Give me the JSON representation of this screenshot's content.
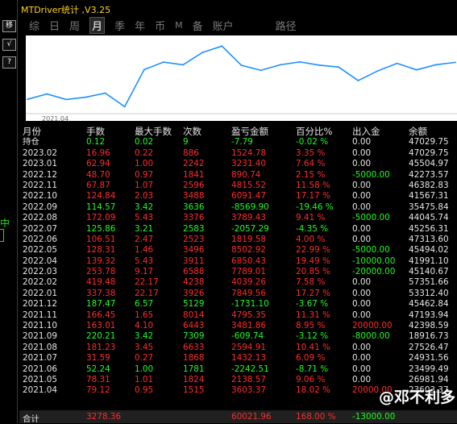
{
  "window": {
    "title": "MTDriver统计 ,V3.25"
  },
  "sidebar": {
    "buttons": [
      "移",
      "√",
      "?"
    ],
    "marker": "中"
  },
  "tabs": [
    {
      "label": "综",
      "active": false
    },
    {
      "label": "日",
      "active": false
    },
    {
      "label": "周",
      "active": false
    },
    {
      "label": "月",
      "active": true
    },
    {
      "label": "季",
      "active": false
    },
    {
      "label": "年",
      "active": false
    },
    {
      "label": "币",
      "active": false
    },
    {
      "label": "M",
      "active": false
    },
    {
      "label": "备",
      "active": false
    },
    {
      "label": "账户",
      "active": false
    },
    {
      "label": "路径",
      "active": false
    }
  ],
  "chart_data": {
    "type": "line",
    "xlabel": "2021.04",
    "x": [
      "2021.04",
      "2021.05",
      "2021.06",
      "2021.07",
      "2021.08",
      "2021.09",
      "2021.10",
      "2021.11",
      "2021.12",
      "2022.01",
      "2022.02",
      "2022.03",
      "2022.04",
      "2022.05",
      "2022.06",
      "2022.07",
      "2022.08",
      "2022.09",
      "2022.10",
      "2022.11",
      "2022.12",
      "2023.01",
      "2023.02"
    ],
    "series": [
      {
        "values": [
          23603.37,
          26981.94,
          23499.49,
          24931.56,
          27526.47,
          18916.73,
          42398.59,
          47193.94,
          45462.84,
          53312.4,
          57351.66,
          45140.67,
          41991.1,
          45494.02,
          47313.6,
          45256.31,
          44045.74,
          35475.84,
          41567.31,
          46382.83,
          42273.57,
          45504.97,
          47029.75
        ]
      }
    ]
  },
  "table": {
    "headers": [
      "月份",
      "手数",
      "最大手数",
      "次数",
      "盈亏金额",
      "百分比%",
      "出入金",
      "余额"
    ],
    "rows": [
      {
        "month": "持仓",
        "lots": "0.12",
        "max_lots": "0.02",
        "count": "9",
        "pnl": "-7.79",
        "pct": "-0.02 %",
        "flow": "0.00",
        "balance": "47029.75",
        "color": "green",
        "flow_color": "white"
      },
      {
        "month": "2023.02",
        "lots": "16.96",
        "max_lots": "0.22",
        "count": "886",
        "pnl": "1524.78",
        "pct": "3.35 %",
        "flow": "0.00",
        "balance": "47029.75",
        "color": "red",
        "flow_color": "white"
      },
      {
        "month": "2023.01",
        "lots": "62.94",
        "max_lots": "1.00",
        "count": "2242",
        "pnl": "3231.40",
        "pct": "7.64 %",
        "flow": "0.00",
        "balance": "45504.97",
        "color": "red",
        "flow_color": "white"
      },
      {
        "month": "2022.12",
        "lots": "48.70",
        "max_lots": "0.97",
        "count": "1841",
        "pnl": "890.74",
        "pct": "2.15 %",
        "flow": "-5000.00",
        "balance": "42273.57",
        "color": "red",
        "flow_color": "green"
      },
      {
        "month": "2022.11",
        "lots": "67.87",
        "max_lots": "1.07",
        "count": "2596",
        "pnl": "4815.52",
        "pct": "11.58 %",
        "flow": "0.00",
        "balance": "46382.83",
        "color": "red",
        "flow_color": "white"
      },
      {
        "month": "2022.10",
        "lots": "124.84",
        "max_lots": "2.03",
        "count": "3488",
        "pnl": "6091.47",
        "pct": "17.17 %",
        "flow": "0.00",
        "balance": "41567.31",
        "color": "red",
        "flow_color": "white"
      },
      {
        "month": "2022.09",
        "lots": "114.57",
        "max_lots": "3.42",
        "count": "3636",
        "pnl": "-8569.90",
        "pct": "-19.46 %",
        "flow": "0.00",
        "balance": "35475.84",
        "color": "green",
        "flow_color": "white"
      },
      {
        "month": "2022.08",
        "lots": "172.09",
        "max_lots": "5.43",
        "count": "3376",
        "pnl": "3789.43",
        "pct": "9.41 %",
        "flow": "-5000.00",
        "balance": "44045.74",
        "color": "red",
        "flow_color": "green"
      },
      {
        "month": "2022.07",
        "lots": "125.86",
        "max_lots": "3.21",
        "count": "2583",
        "pnl": "-2057.29",
        "pct": "-4.35 %",
        "flow": "0.00",
        "balance": "45256.31",
        "color": "green",
        "flow_color": "white"
      },
      {
        "month": "2022.06",
        "lots": "106.51",
        "max_lots": "2.47",
        "count": "2523",
        "pnl": "1819.58",
        "pct": "4.00 %",
        "flow": "0.00",
        "balance": "47313.60",
        "color": "red",
        "flow_color": "white"
      },
      {
        "month": "2022.05",
        "lots": "128.31",
        "max_lots": "1.46",
        "count": "3496",
        "pnl": "8502.92",
        "pct": "22.99 %",
        "flow": "-5000.00",
        "balance": "45494.02",
        "color": "red",
        "flow_color": "green"
      },
      {
        "month": "2022.04",
        "lots": "139.32",
        "max_lots": "5.43",
        "count": "3911",
        "pnl": "6850.43",
        "pct": "19.49 %",
        "flow": "-10000.00",
        "balance": "41991.10",
        "color": "red",
        "flow_color": "green"
      },
      {
        "month": "2022.03",
        "lots": "253.78",
        "max_lots": "9.17",
        "count": "6588",
        "pnl": "7789.01",
        "pct": "20.85 %",
        "flow": "-20000.00",
        "balance": "45140.67",
        "color": "red",
        "flow_color": "green"
      },
      {
        "month": "2022.02",
        "lots": "419.48",
        "max_lots": "22.17",
        "count": "4238",
        "pnl": "4039.26",
        "pct": "7.58 %",
        "flow": "0.00",
        "balance": "57351.66",
        "color": "red",
        "flow_color": "white"
      },
      {
        "month": "2022.01",
        "lots": "337.38",
        "max_lots": "22.17",
        "count": "3926",
        "pnl": "7849.56",
        "pct": "17.27 %",
        "flow": "0.00",
        "balance": "53312.40",
        "color": "red",
        "flow_color": "white"
      },
      {
        "month": "2021.12",
        "lots": "187.47",
        "max_lots": "6.57",
        "count": "5129",
        "pnl": "-1731.10",
        "pct": "-3.67 %",
        "flow": "0.00",
        "balance": "45462.84",
        "color": "green",
        "flow_color": "white"
      },
      {
        "month": "2021.11",
        "lots": "166.45",
        "max_lots": "1.65",
        "count": "8014",
        "pnl": "4795.35",
        "pct": "11.31 %",
        "flow": "0.00",
        "balance": "47193.94",
        "color": "red",
        "flow_color": "white"
      },
      {
        "month": "2021.10",
        "lots": "163.01",
        "max_lots": "4.10",
        "count": "6443",
        "pnl": "3481.86",
        "pct": "8.95 %",
        "flow": "20000.00",
        "balance": "42398.59",
        "color": "red",
        "flow_color": "red"
      },
      {
        "month": "2021.09",
        "lots": "220.21",
        "max_lots": "3.42",
        "count": "7309",
        "pnl": "-609.74",
        "pct": "-3.12 %",
        "flow": "-8000.00",
        "balance": "18916.73",
        "color": "green",
        "flow_color": "green"
      },
      {
        "month": "2021.08",
        "lots": "181.23",
        "max_lots": "3.45",
        "count": "6633",
        "pnl": "2594.91",
        "pct": "10.41 %",
        "flow": "0.00",
        "balance": "27526.47",
        "color": "red",
        "flow_color": "white"
      },
      {
        "month": "2021.07",
        "lots": "31.59",
        "max_lots": "0.27",
        "count": "1868",
        "pnl": "1432.13",
        "pct": "6.09 %",
        "flow": "0.00",
        "balance": "24931.56",
        "color": "red",
        "flow_color": "white"
      },
      {
        "month": "2021.06",
        "lots": "52.24",
        "max_lots": "1.00",
        "count": "1781",
        "pnl": "-2242.51",
        "pct": "-8.71 %",
        "flow": "0.00",
        "balance": "23499.49",
        "color": "green",
        "flow_color": "white"
      },
      {
        "month": "2021.05",
        "lots": "78.31",
        "max_lots": "1.01",
        "count": "1824",
        "pnl": "2138.57",
        "pct": "9.06 %",
        "flow": "0.00",
        "balance": "26981.94",
        "color": "red",
        "flow_color": "white"
      },
      {
        "month": "2021.04",
        "lots": "79.12",
        "max_lots": "0.95",
        "count": "1515",
        "pnl": "3603.37",
        "pct": "18.02 %",
        "flow": "20000.00",
        "balance": "23603.37",
        "color": "red",
        "flow_color": "red"
      }
    ]
  },
  "summary": {
    "label": "合计",
    "lots": "3278.36",
    "pnl": "60021.96",
    "pct": "168.00 %",
    "flow": "-13000.00"
  },
  "watermark": "@邓不利多"
}
